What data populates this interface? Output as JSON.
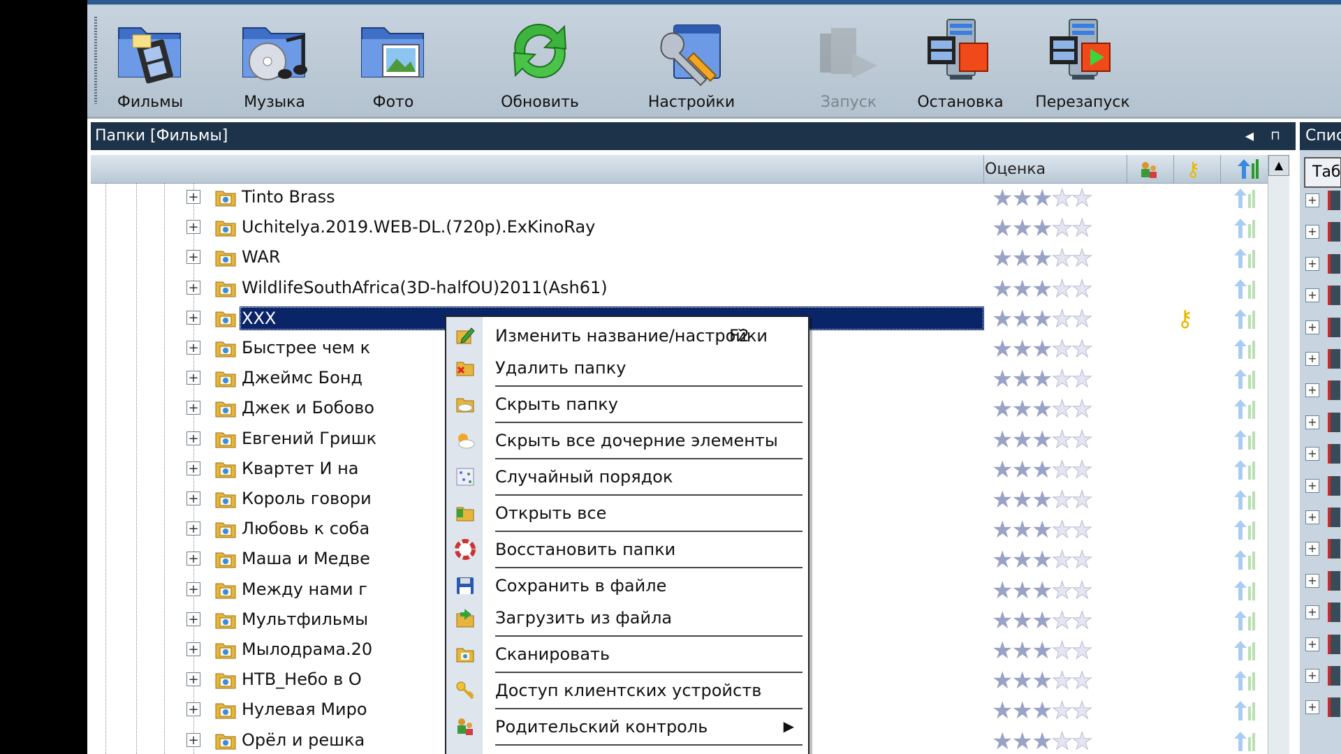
{
  "toolbar": {
    "buttons": [
      {
        "label": "Фильмы",
        "icon": "film-folder-icon"
      },
      {
        "label": "Музыка",
        "icon": "music-folder-icon"
      },
      {
        "label": "Фото",
        "icon": "photo-folder-icon"
      },
      {
        "label": "Обновить",
        "icon": "refresh-icon"
      },
      {
        "label": "Настройки",
        "icon": "settings-icon"
      },
      {
        "label": "Запуск",
        "icon": "start-icon"
      },
      {
        "label": "Остановка",
        "icon": "stop-icon"
      },
      {
        "label": "Перезапуск",
        "icon": "restart-icon"
      }
    ]
  },
  "folders_panel": {
    "title": "Папки [Фильмы]",
    "rating_header": "Оценка"
  },
  "right_pane": {
    "title": "Спис",
    "tab": "Таб"
  },
  "tree": {
    "rows": [
      {
        "name": "Tinto Brass",
        "rating": 3
      },
      {
        "name": "Uchitelya.2019.WEB-DL.(720p).ExKinoRay",
        "rating": 3
      },
      {
        "name": "WAR",
        "rating": 3
      },
      {
        "name": "WildlifeSouthAfrica(3D-halfOU)2011(Ash61)",
        "rating": 3
      },
      {
        "name": "XXX",
        "rating": 3,
        "selected": true,
        "restricted": true
      },
      {
        "name": "Быстрее чем к",
        "rating": 3
      },
      {
        "name": "Джеймс Бонд",
        "rating": 3
      },
      {
        "name": "Джек и Бобово",
        "rating": 3
      },
      {
        "name": "Евгений Гришк",
        "rating": 3
      },
      {
        "name": "Квартет И на",
        "rating": 3
      },
      {
        "name": "Король говори",
        "rating": 3
      },
      {
        "name": "Любовь к соба",
        "rating": 3
      },
      {
        "name": "Маша и Медве",
        "rating": 3
      },
      {
        "name": "Между нами г",
        "rating": 3
      },
      {
        "name": "Мультфильмы",
        "rating": 3
      },
      {
        "name": "Мылодрама.20",
        "rating": 3
      },
      {
        "name": "НТВ_Небо в О",
        "rating": 3
      },
      {
        "name": "Нулевая Миро",
        "rating": 3
      },
      {
        "name": "Орёл и решка",
        "rating": 3
      }
    ]
  },
  "context_menu": {
    "items": [
      {
        "label": "Изменить название/настройки",
        "shortcut": "F2",
        "icon": "edit-icon"
      },
      {
        "label": "Удалить папку",
        "icon": "delete-folder-icon"
      },
      {
        "label": "Скрыть папку",
        "icon": "hide-folder-icon"
      },
      {
        "label": "Скрыть все дочерние элементы",
        "icon": "hide-children-icon"
      },
      {
        "label": "Случайный порядок",
        "icon": "random-order-icon"
      },
      {
        "label": "Открыть все",
        "icon": "open-all-icon"
      },
      {
        "label": "Восстановить папки",
        "icon": "lifebuoy-icon"
      },
      {
        "label": "Сохранить в файле",
        "icon": "floppy-icon"
      },
      {
        "label": "Загрузить из файла",
        "icon": "load-file-icon"
      },
      {
        "label": "Сканировать",
        "icon": "scan-icon"
      },
      {
        "label": "Доступ клиентских устройств",
        "icon": "key-icon"
      },
      {
        "label": "Родительский контроль",
        "icon": "parental-control-icon",
        "submenu": true
      }
    ]
  }
}
